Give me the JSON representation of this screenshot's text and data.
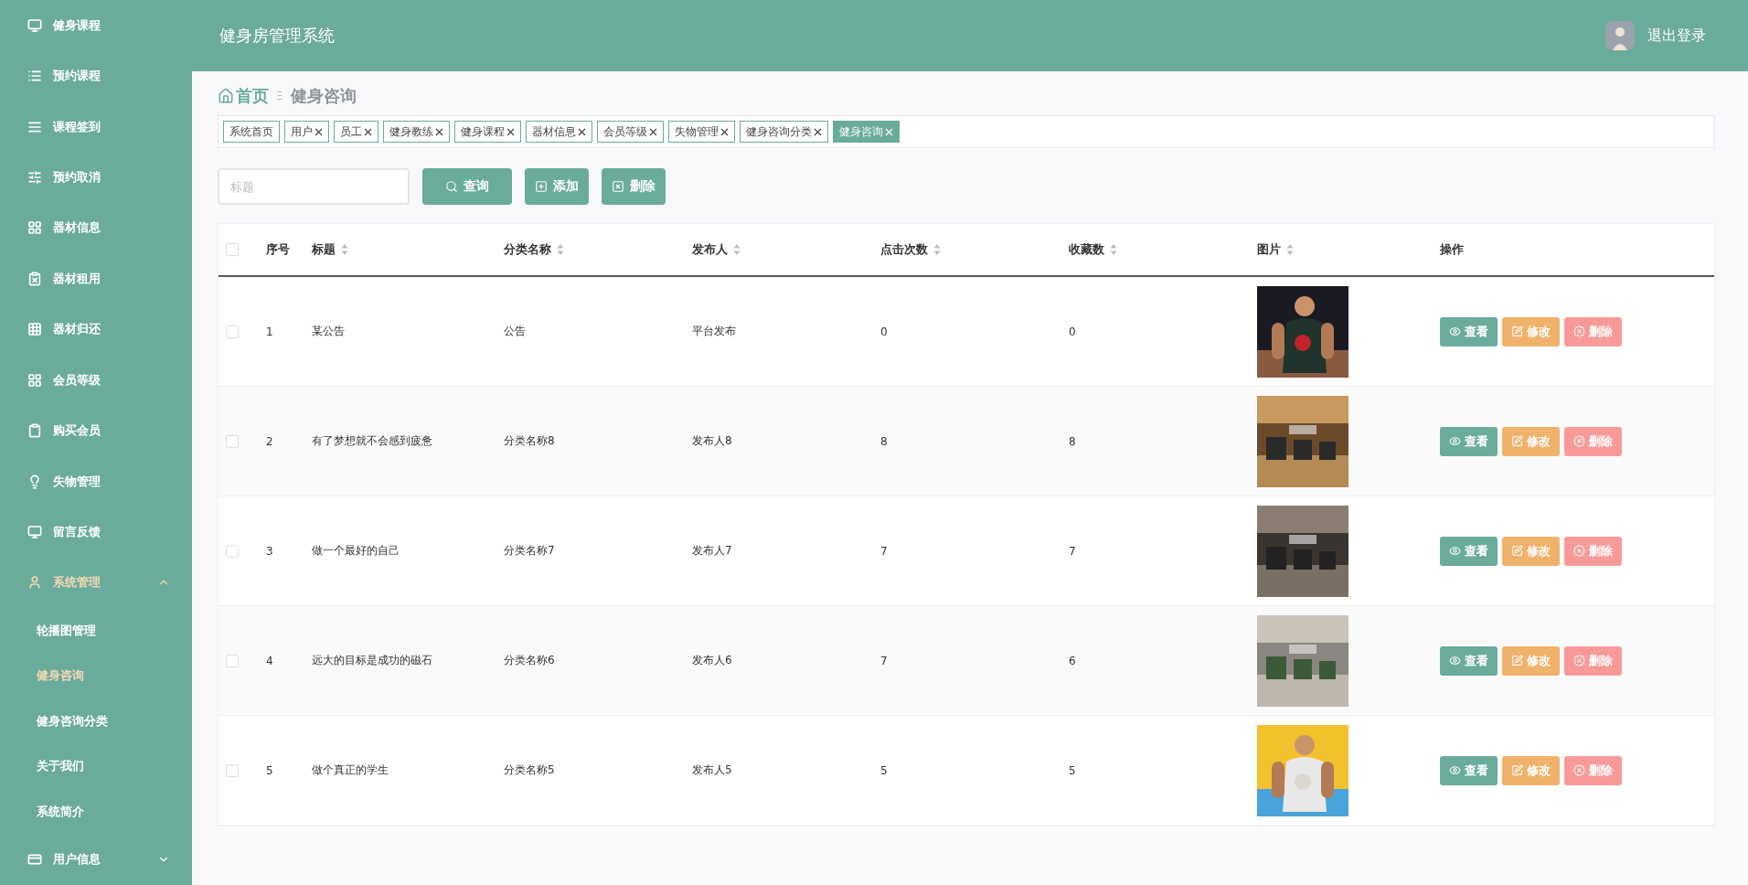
{
  "header": {
    "title": "健身房管理系统",
    "logout": "退出登录"
  },
  "sidebar": {
    "items": [
      {
        "label": "健身课程",
        "active": false
      },
      {
        "label": "预约课程",
        "active": false
      },
      {
        "label": "课程签到",
        "active": false
      },
      {
        "label": "预约取消",
        "active": false
      },
      {
        "label": "器材信息",
        "active": false
      },
      {
        "label": "器材租用",
        "active": false
      },
      {
        "label": "器材归还",
        "active": false
      },
      {
        "label": "会员等级",
        "active": false
      },
      {
        "label": "购买会员",
        "active": false
      },
      {
        "label": "失物管理",
        "active": false
      },
      {
        "label": "留言反馈",
        "active": false
      },
      {
        "label": "系统管理",
        "active": true,
        "expanded": true,
        "children": [
          {
            "label": "轮播图管理",
            "selected": false
          },
          {
            "label": "健身咨询",
            "selected": true
          },
          {
            "label": "健身咨询分类",
            "selected": false
          },
          {
            "label": "关于我们",
            "selected": false
          },
          {
            "label": "系统简介",
            "selected": false
          }
        ]
      },
      {
        "label": "用户信息",
        "active": false,
        "expanded": false
      }
    ]
  },
  "breadcrumb": {
    "home": "首页",
    "separator": "Ξ",
    "current": "健身咨询"
  },
  "tags": [
    {
      "label": "系统首页",
      "closable": false,
      "selected": false
    },
    {
      "label": "用户",
      "closable": true,
      "selected": false
    },
    {
      "label": "员工",
      "closable": true,
      "selected": false
    },
    {
      "label": "健身教练",
      "closable": true,
      "selected": false
    },
    {
      "label": "健身课程",
      "closable": true,
      "selected": false
    },
    {
      "label": "器材信息",
      "closable": true,
      "selected": false
    },
    {
      "label": "会员等级",
      "closable": true,
      "selected": false
    },
    {
      "label": "失物管理",
      "closable": true,
      "selected": false
    },
    {
      "label": "健身咨询分类",
      "closable": true,
      "selected": false
    },
    {
      "label": "健身咨询",
      "closable": true,
      "selected": true
    }
  ],
  "search": {
    "placeholder": "标题",
    "buttons": [
      {
        "label": "查询",
        "kind": "search"
      },
      {
        "label": "添加",
        "kind": "add"
      },
      {
        "label": "删除",
        "kind": "delete"
      }
    ]
  },
  "table": {
    "columns": [
      {
        "label": "序号",
        "sortable": false
      },
      {
        "label": "标题",
        "sortable": true
      },
      {
        "label": "分类名称",
        "sortable": true
      },
      {
        "label": "发布人",
        "sortable": true
      },
      {
        "label": "点击次数",
        "sortable": true
      },
      {
        "label": "收藏数",
        "sortable": true
      },
      {
        "label": "图片",
        "sortable": true
      },
      {
        "label": "操作",
        "sortable": false
      }
    ],
    "rows": [
      {
        "checked": false,
        "cells": [
          "1",
          "某公告",
          "公告",
          "平台发布",
          "0",
          "0"
        ],
        "actions": [
          {
            "label": "查看",
            "kind": "view"
          },
          {
            "label": "修改",
            "kind": "edit"
          },
          {
            "label": "删除",
            "kind": "delete"
          }
        ]
      },
      {
        "checked": false,
        "cells": [
          "2",
          "有了梦想就不会感到疲惫",
          "分类名称8",
          "发布人8",
          "8",
          "8"
        ],
        "actions": [
          {
            "label": "查看",
            "kind": "view"
          },
          {
            "label": "修改",
            "kind": "edit"
          },
          {
            "label": "删除",
            "kind": "delete"
          }
        ]
      },
      {
        "checked": false,
        "cells": [
          "3",
          "做一个最好的自己",
          "分类名称7",
          "发布人7",
          "7",
          "7"
        ],
        "actions": [
          {
            "label": "查看",
            "kind": "view"
          },
          {
            "label": "修改",
            "kind": "edit"
          },
          {
            "label": "删除",
            "kind": "delete"
          }
        ]
      },
      {
        "checked": false,
        "cells": [
          "4",
          "远大的目标是成功的磁石",
          "分类名称6",
          "发布人6",
          "7",
          "6"
        ],
        "actions": [
          {
            "label": "查看",
            "kind": "view"
          },
          {
            "label": "修改",
            "kind": "edit"
          },
          {
            "label": "删除",
            "kind": "delete"
          }
        ]
      },
      {
        "checked": false,
        "cells": [
          "5",
          "做个真正的学生",
          "分类名称5",
          "发布人5",
          "5",
          "5"
        ],
        "actions": [
          {
            "label": "查看",
            "kind": "view"
          },
          {
            "label": "修改",
            "kind": "edit"
          },
          {
            "label": "删除",
            "kind": "delete"
          }
        ]
      }
    ],
    "select_all_checked": false
  }
}
